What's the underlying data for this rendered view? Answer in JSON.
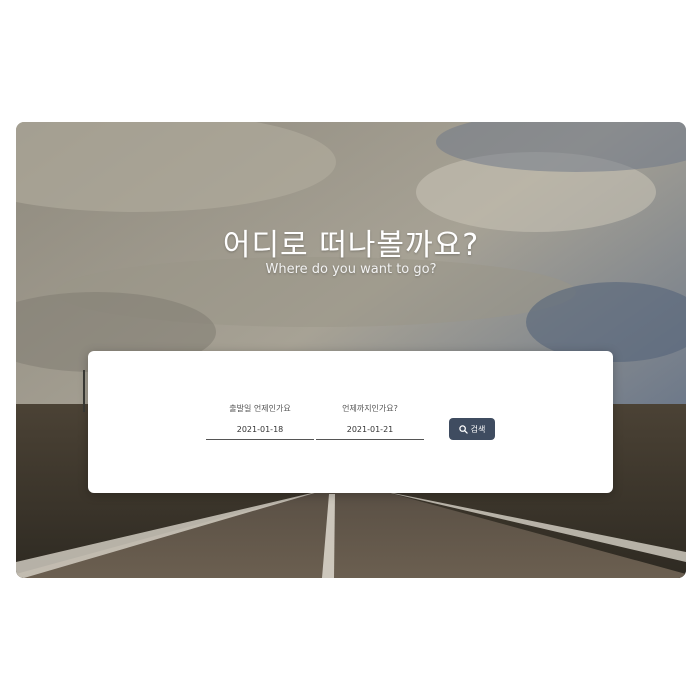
{
  "hero": {
    "title": "어디로 떠나볼까요?",
    "subtitle": "Where do you want to go?",
    "background_icon": "road-sky-landscape"
  },
  "search_form": {
    "checkin": {
      "label": "출발일 언제인가요",
      "value": "2021-01-18"
    },
    "checkout": {
      "label": "언제까지인가요?",
      "value": "2021-01-21"
    },
    "search_button": {
      "label": "검색",
      "icon": "search-icon"
    }
  },
  "colors": {
    "button_bg": "#3f4c60",
    "card_bg": "#ffffff",
    "sky": "#8f9aa8",
    "road": "#4a4136"
  }
}
